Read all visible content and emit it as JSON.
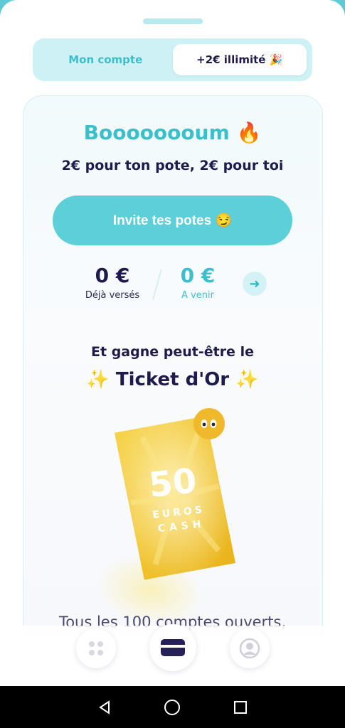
{
  "segmented": {
    "tab_account": "Mon compte",
    "tab_referral": "+2€ illimité 🎉"
  },
  "hero": {
    "headline": "Boooooooum 🔥",
    "subline": "2€ pour ton pote, 2€ pour toi",
    "invite_label": "Invite tes potes 😏"
  },
  "stats": {
    "paid_value": "0 €",
    "paid_label": "Déjà versés",
    "pending_value": "0 €",
    "pending_label": "A venir"
  },
  "ticket": {
    "intro": "Et gagne peut-être le",
    "title": "Ticket d'Or",
    "amount": "50",
    "line1": "EUROS",
    "line2": "CASH"
  },
  "footer_text": "Tous les 100 comptes ouverts,",
  "tabs": {
    "home_icon": "grid-icon",
    "card_icon": "card-icon",
    "profile_icon": "profile-icon"
  },
  "colors": {
    "accent": "#5ccfd8",
    "navy": "#1e1a4d",
    "gold": "#f3c330"
  }
}
